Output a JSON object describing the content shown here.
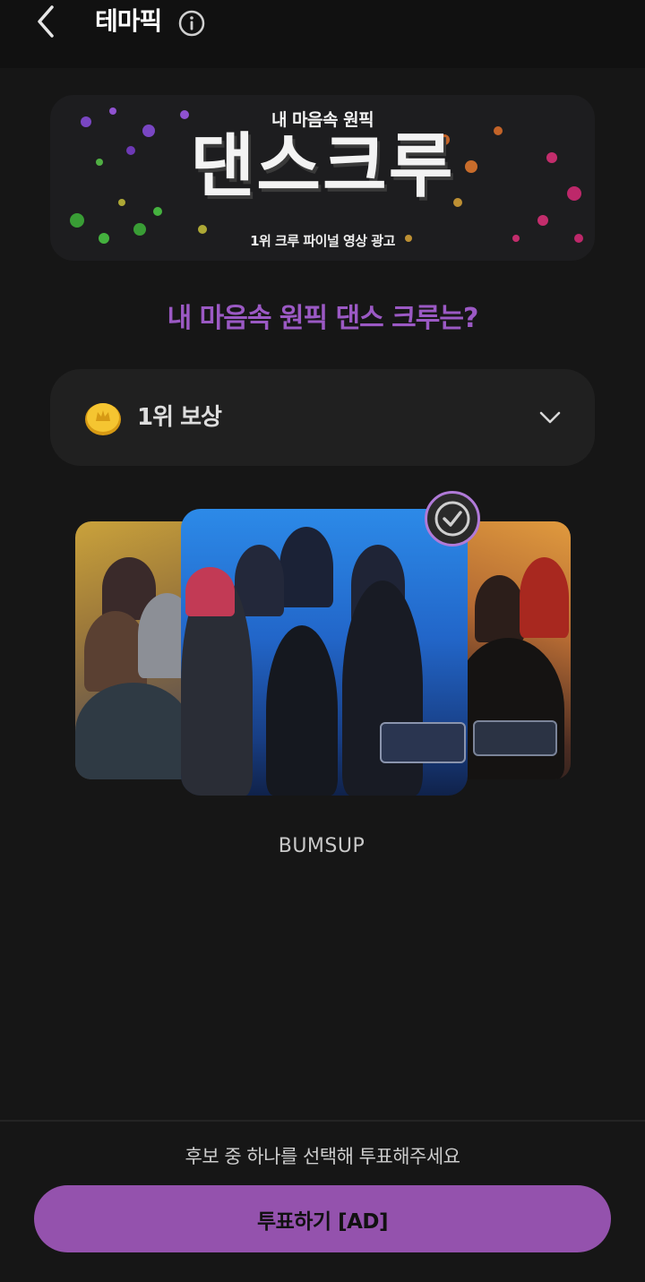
{
  "header": {
    "title": "테마픽",
    "back_icon": "chevron-left-icon",
    "info_icon": "info-icon"
  },
  "banner": {
    "subtitle": "내 마음속 원픽",
    "title": "댄스크루",
    "caption": "1위 크루 파이널 영상 광고"
  },
  "question": "내 마음속 원픽 댄스 크루는?",
  "reward": {
    "label": "1위 보상",
    "icon": "coin-icon",
    "expand_icon": "chevron-down-icon"
  },
  "carousel": {
    "selected_name": "BUMSUP",
    "selected_icon": "check-icon"
  },
  "footer": {
    "instruction": "후보 중 하나를 선택해 투표해주세요",
    "vote_label": "투표하기 [AD]"
  },
  "colors": {
    "accent": "#9452ad",
    "question": "#9b59c4",
    "background": "#161616"
  }
}
